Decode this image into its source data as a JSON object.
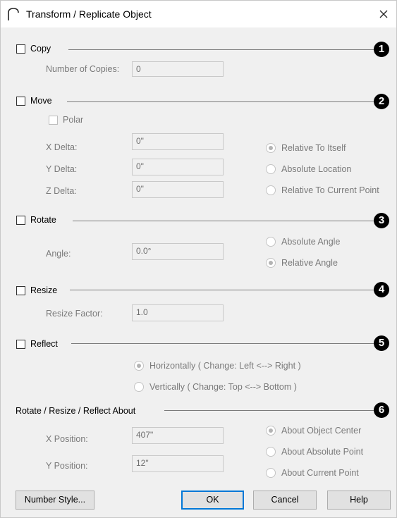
{
  "window": {
    "title": "Transform / Replicate Object"
  },
  "copy": {
    "label": "Copy",
    "number_label": "Number of Copies:",
    "number_value": "0",
    "badge": "1"
  },
  "move": {
    "label": "Move",
    "badge": "2",
    "polar_label": "Polar",
    "x_label": "X Delta:",
    "x_value": "0\"",
    "y_label": "Y Delta:",
    "y_value": "0\"",
    "z_label": "Z Delta:",
    "z_value": "0\"",
    "radio_itself": "Relative To Itself",
    "radio_absolute": "Absolute Location",
    "radio_current": "Relative To Current Point"
  },
  "rotate": {
    "label": "Rotate",
    "badge": "3",
    "angle_label": "Angle:",
    "angle_value": "0.0°",
    "radio_absolute": "Absolute Angle",
    "radio_relative": "Relative Angle"
  },
  "resize": {
    "label": "Resize",
    "badge": "4",
    "factor_label": "Resize Factor:",
    "factor_value": "1.0"
  },
  "reflect": {
    "label": "Reflect",
    "badge": "5",
    "radio_horiz": "Horizontally ( Change: Left <--> Right )",
    "radio_vert": "Vertically ( Change: Top <--> Bottom )"
  },
  "about": {
    "label": "Rotate / Resize / Reflect About",
    "badge": "6",
    "x_label": "X Position:",
    "x_value": "407\"",
    "y_label": "Y Position:",
    "y_value": "12\"",
    "radio_center": "About Object Center",
    "radio_absolute": "About Absolute Point",
    "radio_current": "About Current Point"
  },
  "buttons": {
    "number_style": "Number Style...",
    "ok": "OK",
    "cancel": "Cancel",
    "help": "Help"
  }
}
